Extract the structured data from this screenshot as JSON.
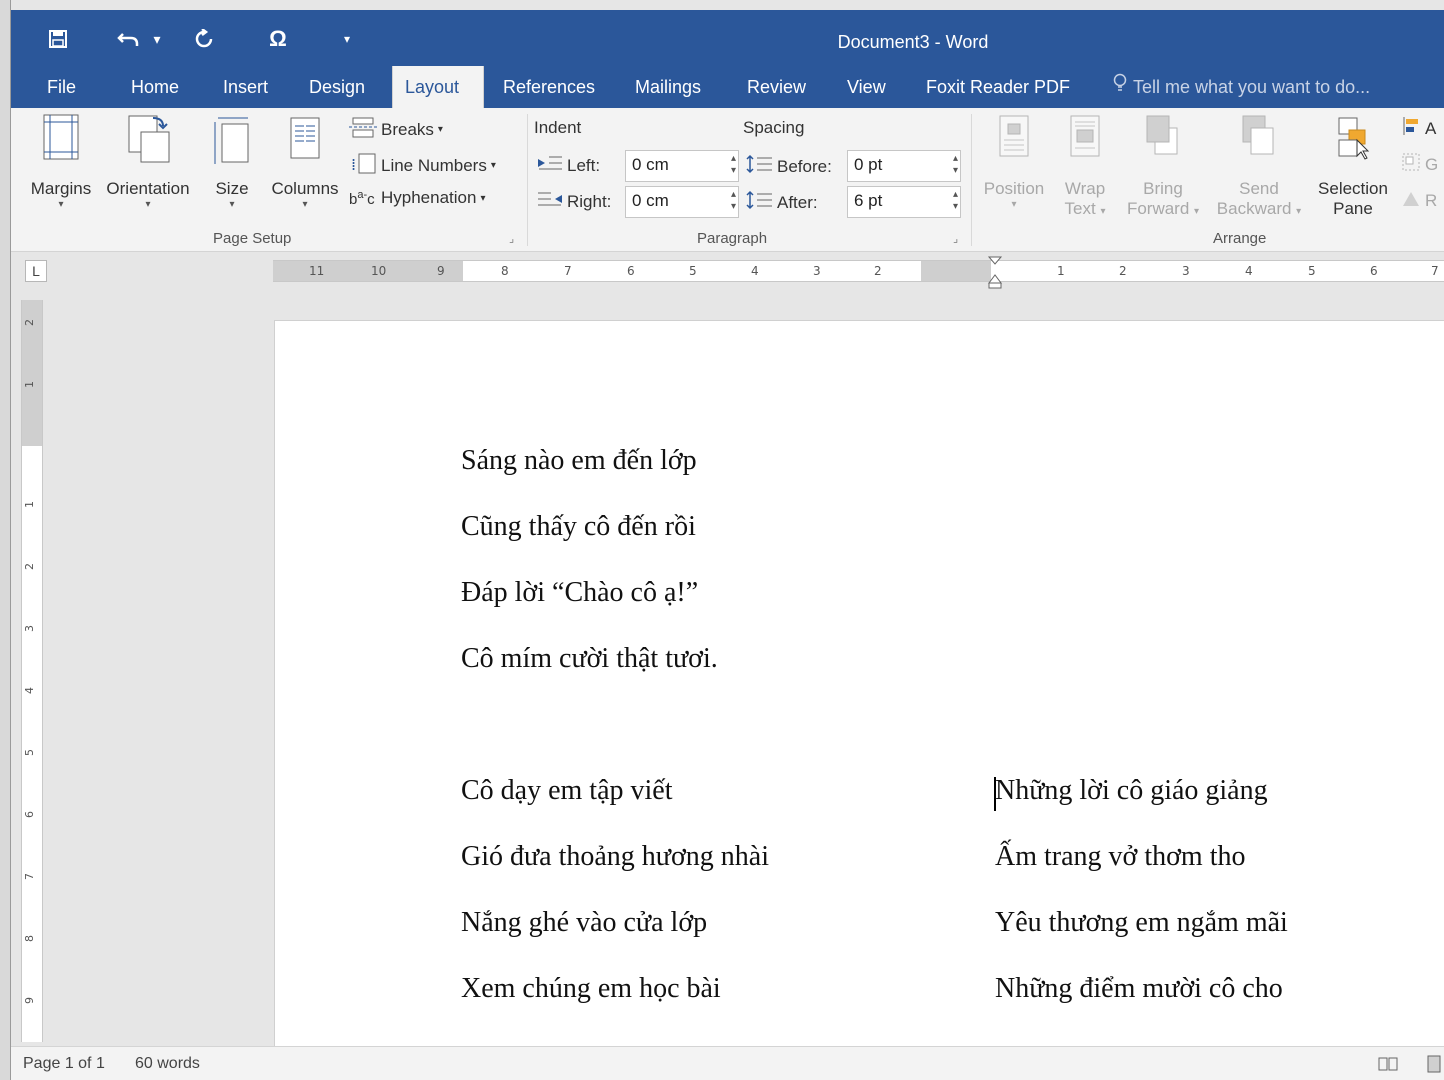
{
  "window": {
    "title": "Document3 - Word"
  },
  "quick_access": [
    {
      "name": "save-icon"
    },
    {
      "name": "undo-icon"
    },
    {
      "name": "undo-dropdown-icon"
    },
    {
      "name": "redo-icon"
    },
    {
      "name": "symbol-icon"
    },
    {
      "name": "customize-qat-icon"
    }
  ],
  "tabs": [
    "File",
    "Home",
    "Insert",
    "Design",
    "Layout",
    "References",
    "Mailings",
    "Review",
    "View",
    "Foxit Reader PDF"
  ],
  "active_tab": "Layout",
  "tell_me": "Tell me what you want to do...",
  "ribbon": {
    "page_setup": {
      "label": "Page Setup",
      "margins": "Margins",
      "orientation": "Orientation",
      "size": "Size",
      "columns": "Columns",
      "breaks": "Breaks",
      "line_numbers": "Line Numbers",
      "hyphenation": "Hyphenation"
    },
    "paragraph": {
      "label": "Paragraph",
      "indent": "Indent",
      "spacing": "Spacing",
      "left_label": "Left:",
      "left_value": "0 cm",
      "right_label": "Right:",
      "right_value": "0 cm",
      "before_label": "Before:",
      "before_value": "0 pt",
      "after_label": "After:",
      "after_value": "6 pt"
    },
    "arrange": {
      "label": "Arrange",
      "position": "Position",
      "wrap_1": "Wrap",
      "wrap_2": "Text",
      "bring_1": "Bring",
      "bring_2": "Forward",
      "send_1": "Send",
      "send_2": "Backward",
      "selection_1": "Selection",
      "selection_2": "Pane",
      "align_partial": "A",
      "group_partial": "G",
      "rotate_partial": "R"
    }
  },
  "ruler": {
    "tab_selector": "L",
    "left_ticks": [
      "11",
      "10",
      "9",
      "8",
      "7",
      "6",
      "5",
      "4",
      "3",
      "2"
    ],
    "right_ticks": [
      "1",
      "2",
      "3",
      "4",
      "5",
      "6",
      "7"
    ],
    "vertical_ticks": [
      "2",
      "1",
      "1",
      "2",
      "3",
      "4",
      "5",
      "6",
      "7",
      "8",
      "9"
    ]
  },
  "document": {
    "stanza1": [
      "Sáng nào em đến lớp",
      "Cũng thấy cô đến rồi",
      "Đáp lời “Chào cô ạ!”",
      "Cô mím cười thật tươi."
    ],
    "column_left": [
      "Cô dạy em tập viết",
      "Gió đưa thoảng hương nhài",
      "Nắng ghé vào cửa lớp",
      "Xem chúng em học bài"
    ],
    "column_right": [
      "Những lời cô giáo giảng",
      "Ấm trang vở thơm tho",
      "Yêu thương em ngắm mãi",
      "Những điểm mười cô cho"
    ]
  },
  "status": {
    "page": "Page 1 of 1",
    "words": "60 words"
  },
  "colors": {
    "title_bar": "#2b579a",
    "ribbon": "#f3f3f3",
    "canvas": "#e6e6e6"
  }
}
